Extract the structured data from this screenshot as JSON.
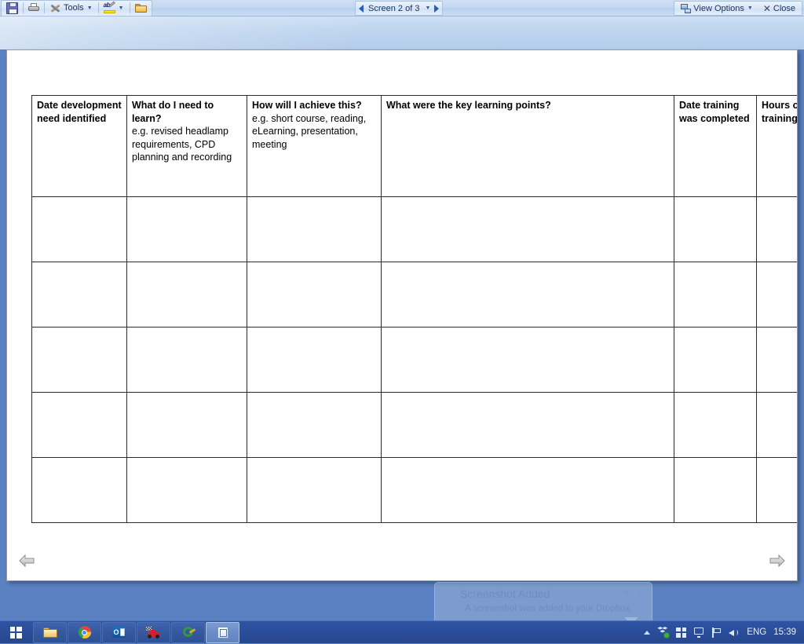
{
  "toolbar": {
    "save_label": "Save",
    "print_label": "Print",
    "tools_label": "Tools",
    "highlight_label": "Highlight",
    "folder_label": "Open Folder",
    "pager": {
      "prev_label": "Previous screen",
      "text": "Screen 2 of 3",
      "next_label": "Next screen",
      "current": 2,
      "total": 3
    },
    "view_options_label": "View Options",
    "close_label": "Close"
  },
  "document": {
    "prev_page_label": "Previous page",
    "next_page_label": "Next page",
    "table": {
      "headers": [
        {
          "title": "Date development need identified",
          "example": ""
        },
        {
          "title": "What do I need to learn?",
          "example": "e.g. revised headlamp requirements, CPD planning and recording"
        },
        {
          "title": "How will I achieve this?",
          "example": "e.g. short course, reading, eLearning, presentation, meeting"
        },
        {
          "title": "What were the key learning points?",
          "example": ""
        },
        {
          "title": "Date training was completed",
          "example": ""
        },
        {
          "title": "Hours of training",
          "example": ""
        }
      ],
      "rows": [
        [
          "",
          "",
          "",
          "",
          "",
          ""
        ],
        [
          "",
          "",
          "",
          "",
          "",
          ""
        ],
        [
          "",
          "",
          "",
          "",
          "",
          ""
        ],
        [
          "",
          "",
          "",
          "",
          "",
          ""
        ],
        [
          "",
          "",
          "",
          "",
          "",
          ""
        ]
      ]
    }
  },
  "notification": {
    "title": "Screenshot Added",
    "body": "A screenshot was added to your Dropbox.",
    "actions": "↖ ×"
  },
  "taskbar": {
    "start_label": "Start",
    "tasks": [
      {
        "name": "file-explorer",
        "label": "File Explorer"
      },
      {
        "name": "google-chrome",
        "label": "Google Chrome"
      },
      {
        "name": "microsoft-outlook",
        "label": "Microsoft Outlook"
      },
      {
        "name": "racing-game",
        "label": "Racing Game"
      },
      {
        "name": "green-app",
        "label": "Application"
      },
      {
        "name": "document-viewer",
        "label": "Document Viewer"
      }
    ],
    "tray": {
      "show_hidden_label": "Show hidden icons",
      "dropbox_label": "Dropbox",
      "windows_label": "Windows",
      "display_label": "Display",
      "action_center_label": "Action Center",
      "volume_label": "Volume",
      "language": "ENG",
      "clock": "15:39"
    }
  },
  "colors": {
    "taskbar": "#2a4d99",
    "desktop": "#5a82c2",
    "toolbar": "#c2d7f0",
    "table_border": "#2b2b2b"
  }
}
